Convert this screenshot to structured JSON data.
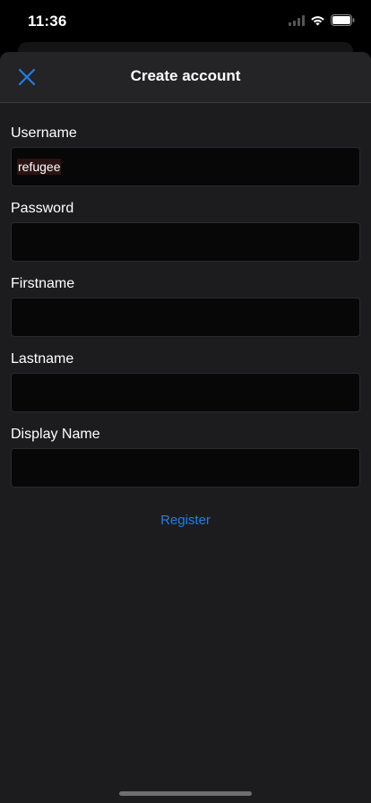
{
  "status_bar": {
    "time": "11:36"
  },
  "nav": {
    "title": "Create account",
    "close_icon": "close-x-icon"
  },
  "form": {
    "fields": [
      {
        "label": "Username",
        "value": "refugee"
      },
      {
        "label": "Password",
        "value": ""
      },
      {
        "label": "Firstname",
        "value": ""
      },
      {
        "label": "Lastname",
        "value": ""
      },
      {
        "label": "Display Name",
        "value": ""
      }
    ],
    "register_label": "Register"
  },
  "colors": {
    "accent": "#1f7fe6",
    "sheet_background": "#1c1c1e",
    "input_background": "#070707"
  }
}
